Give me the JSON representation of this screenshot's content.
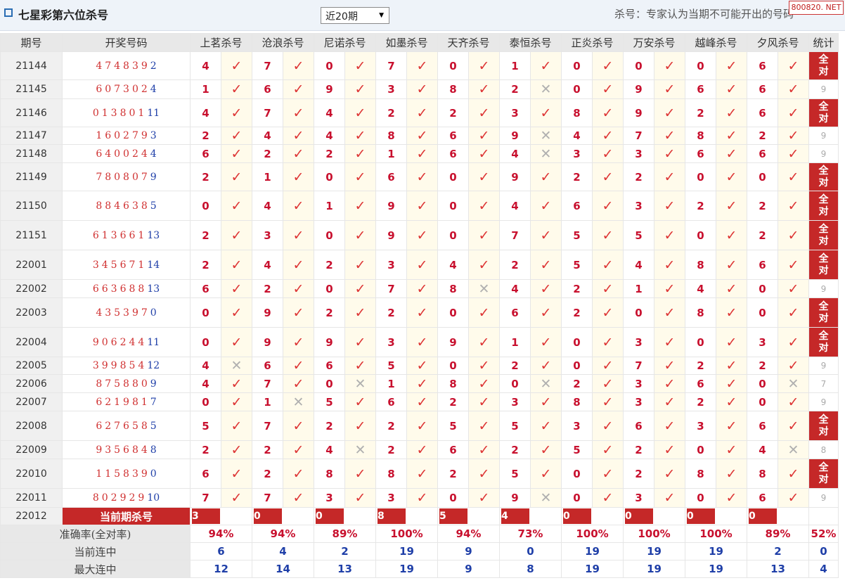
{
  "title": "七星彩第六位杀号",
  "period_select": {
    "value": "近20期",
    "arrow": "▼"
  },
  "hint": "杀号：专家认为当期不可能开出的号码",
  "watermark": "800820. NET",
  "headers": [
    "期号",
    "开奖号码",
    "上茗杀号",
    "沧浪杀号",
    "尼诺杀号",
    "如墨杀号",
    "天齐杀号",
    "泰恒杀号",
    "正炎杀号",
    "万安杀号",
    "越峰杀号",
    "夕风杀号",
    "统计"
  ],
  "marks": {
    "ok": "✓",
    "bad": "✕"
  },
  "rows": [
    {
      "issue": "21144",
      "digits": "474839",
      "sum": "2",
      "kills": [
        "4",
        "7",
        "0",
        "7",
        "0",
        "1",
        "0",
        "0",
        "0",
        "6"
      ],
      "ok": [
        1,
        1,
        1,
        1,
        1,
        1,
        1,
        1,
        1,
        1
      ],
      "stat": "全对",
      "full": true
    },
    {
      "issue": "21145",
      "digits": "607302",
      "sum": "4",
      "kills": [
        "1",
        "6",
        "9",
        "3",
        "8",
        "2",
        "0",
        "9",
        "6",
        "6"
      ],
      "ok": [
        1,
        1,
        1,
        1,
        1,
        0,
        1,
        1,
        1,
        1
      ],
      "stat": "9",
      "full": false
    },
    {
      "issue": "21146",
      "digits": "013801",
      "sum": "11",
      "kills": [
        "4",
        "7",
        "4",
        "2",
        "2",
        "3",
        "8",
        "9",
        "2",
        "6"
      ],
      "ok": [
        1,
        1,
        1,
        1,
        1,
        1,
        1,
        1,
        1,
        1
      ],
      "stat": "全对",
      "full": true
    },
    {
      "issue": "21147",
      "digits": "160279",
      "sum": "3",
      "kills": [
        "2",
        "4",
        "4",
        "8",
        "6",
        "9",
        "4",
        "7",
        "8",
        "2"
      ],
      "ok": [
        1,
        1,
        1,
        1,
        1,
        0,
        1,
        1,
        1,
        1
      ],
      "stat": "9",
      "full": false
    },
    {
      "issue": "21148",
      "digits": "640024",
      "sum": "4",
      "kills": [
        "6",
        "2",
        "2",
        "1",
        "6",
        "4",
        "3",
        "3",
        "6",
        "6"
      ],
      "ok": [
        1,
        1,
        1,
        1,
        1,
        0,
        1,
        1,
        1,
        1
      ],
      "stat": "9",
      "full": false
    },
    {
      "issue": "21149",
      "digits": "780807",
      "sum": "9",
      "kills": [
        "2",
        "1",
        "0",
        "6",
        "0",
        "9",
        "2",
        "2",
        "0",
        "0"
      ],
      "ok": [
        1,
        1,
        1,
        1,
        1,
        1,
        1,
        1,
        1,
        1
      ],
      "stat": "全对",
      "full": true
    },
    {
      "issue": "21150",
      "digits": "884638",
      "sum": "5",
      "kills": [
        "0",
        "4",
        "1",
        "9",
        "0",
        "4",
        "6",
        "3",
        "2",
        "2"
      ],
      "ok": [
        1,
        1,
        1,
        1,
        1,
        1,
        1,
        1,
        1,
        1
      ],
      "stat": "全对",
      "full": true
    },
    {
      "issue": "21151",
      "digits": "613661",
      "sum": "13",
      "kills": [
        "2",
        "3",
        "0",
        "9",
        "0",
        "7",
        "5",
        "5",
        "0",
        "2"
      ],
      "ok": [
        1,
        1,
        1,
        1,
        1,
        1,
        1,
        1,
        1,
        1
      ],
      "stat": "全对",
      "full": true
    },
    {
      "issue": "22001",
      "digits": "345671",
      "sum": "14",
      "kills": [
        "2",
        "4",
        "2",
        "3",
        "4",
        "2",
        "5",
        "4",
        "8",
        "6"
      ],
      "ok": [
        1,
        1,
        1,
        1,
        1,
        1,
        1,
        1,
        1,
        1
      ],
      "stat": "全对",
      "full": true
    },
    {
      "issue": "22002",
      "digits": "663688",
      "sum": "13",
      "kills": [
        "6",
        "2",
        "0",
        "7",
        "8",
        "4",
        "2",
        "1",
        "4",
        "0"
      ],
      "ok": [
        1,
        1,
        1,
        1,
        0,
        1,
        1,
        1,
        1,
        1
      ],
      "stat": "9",
      "full": false
    },
    {
      "issue": "22003",
      "digits": "435397",
      "sum": "0",
      "kills": [
        "0",
        "9",
        "2",
        "2",
        "0",
        "6",
        "2",
        "0",
        "8",
        "0"
      ],
      "ok": [
        1,
        1,
        1,
        1,
        1,
        1,
        1,
        1,
        1,
        1
      ],
      "stat": "全对",
      "full": true
    },
    {
      "issue": "22004",
      "digits": "906244",
      "sum": "11",
      "kills": [
        "0",
        "9",
        "9",
        "3",
        "9",
        "1",
        "0",
        "3",
        "0",
        "3"
      ],
      "ok": [
        1,
        1,
        1,
        1,
        1,
        1,
        1,
        1,
        1,
        1
      ],
      "stat": "全对",
      "full": true
    },
    {
      "issue": "22005",
      "digits": "399854",
      "sum": "12",
      "kills": [
        "4",
        "6",
        "6",
        "5",
        "0",
        "2",
        "0",
        "7",
        "2",
        "2"
      ],
      "ok": [
        0,
        1,
        1,
        1,
        1,
        1,
        1,
        1,
        1,
        1
      ],
      "stat": "9",
      "full": false
    },
    {
      "issue": "22006",
      "digits": "875880",
      "sum": "9",
      "kills": [
        "4",
        "7",
        "0",
        "1",
        "8",
        "0",
        "2",
        "3",
        "6",
        "0"
      ],
      "ok": [
        1,
        1,
        0,
        1,
        1,
        0,
        1,
        1,
        1,
        0
      ],
      "stat": "7",
      "full": false
    },
    {
      "issue": "22007",
      "digits": "621981",
      "sum": "7",
      "kills": [
        "0",
        "1",
        "5",
        "6",
        "2",
        "3",
        "8",
        "3",
        "2",
        "0"
      ],
      "ok": [
        1,
        0,
        1,
        1,
        1,
        1,
        1,
        1,
        1,
        1
      ],
      "stat": "9",
      "full": false
    },
    {
      "issue": "22008",
      "digits": "627658",
      "sum": "5",
      "kills": [
        "5",
        "7",
        "2",
        "2",
        "5",
        "5",
        "3",
        "6",
        "3",
        "6"
      ],
      "ok": [
        1,
        1,
        1,
        1,
        1,
        1,
        1,
        1,
        1,
        1
      ],
      "stat": "全对",
      "full": true
    },
    {
      "issue": "22009",
      "digits": "935684",
      "sum": "8",
      "kills": [
        "2",
        "2",
        "4",
        "2",
        "6",
        "2",
        "5",
        "2",
        "0",
        "4"
      ],
      "ok": [
        1,
        1,
        0,
        1,
        1,
        1,
        1,
        1,
        1,
        0
      ],
      "stat": "8",
      "full": false
    },
    {
      "issue": "22010",
      "digits": "115839",
      "sum": "0",
      "kills": [
        "6",
        "2",
        "8",
        "8",
        "2",
        "5",
        "0",
        "2",
        "8",
        "8"
      ],
      "ok": [
        1,
        1,
        1,
        1,
        1,
        1,
        1,
        1,
        1,
        1
      ],
      "stat": "全对",
      "full": true
    },
    {
      "issue": "22011",
      "digits": "802929",
      "sum": "10",
      "kills": [
        "7",
        "7",
        "3",
        "3",
        "0",
        "9",
        "0",
        "3",
        "0",
        "6"
      ],
      "ok": [
        1,
        1,
        1,
        1,
        1,
        0,
        1,
        1,
        1,
        1
      ],
      "stat": "9",
      "full": false
    }
  ],
  "current": {
    "issue": "22012",
    "label": "当前期杀号",
    "kills": [
      "3",
      "0",
      "0",
      "8",
      "5",
      "4",
      "0",
      "0",
      "0",
      "0"
    ]
  },
  "footer": {
    "accuracy": {
      "label": "准确率(全对率)",
      "values": [
        "94%",
        "94%",
        "89%",
        "100%",
        "94%",
        "73%",
        "100%",
        "100%",
        "100%",
        "89%"
      ],
      "total": "52%"
    },
    "streak": {
      "label": "当前连中",
      "values": [
        "6",
        "4",
        "2",
        "19",
        "9",
        "0",
        "19",
        "19",
        "19",
        "2"
      ],
      "total": "0"
    },
    "max_streak": {
      "label": "最大连中",
      "values": [
        "12",
        "14",
        "13",
        "19",
        "9",
        "8",
        "19",
        "19",
        "19",
        "13"
      ],
      "total": "4"
    }
  },
  "colors": {
    "accent_red": "#c52828",
    "kill_red": "#c8102e",
    "sum_blue": "#1f3fa8",
    "mark_bg": "#fffbeb"
  }
}
